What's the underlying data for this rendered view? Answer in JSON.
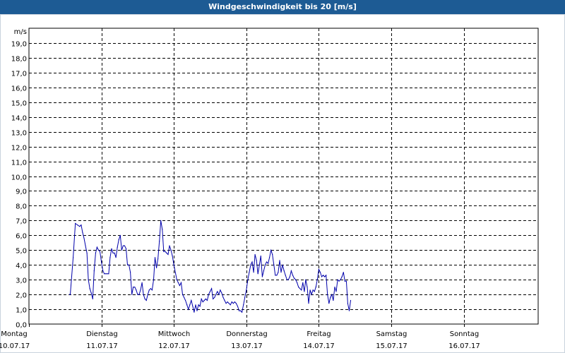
{
  "window": {
    "title": "Windgeschwindigkeit bis 20 [m/s]"
  },
  "colors": {
    "titlebar": "#1d5b94",
    "line": "#0000aa",
    "grid": "#000000"
  },
  "chart_data": {
    "type": "line",
    "title": "Windgeschwindigkeit bis 20 [m/s]",
    "ylabel": "m/s",
    "ylim": [
      0,
      20
    ],
    "xlim": [
      0,
      7
    ],
    "grid": true,
    "y_ticks": [
      "0,0",
      "1,0",
      "2,0",
      "3,0",
      "4,0",
      "5,0",
      "6,0",
      "7,0",
      "8,0",
      "9,0",
      "10,0",
      "11,0",
      "12,0",
      "13,0",
      "14,0",
      "15,0",
      "16,0",
      "17,0",
      "18,0",
      "19,0"
    ],
    "x_ticks": [
      {
        "day": "Montag",
        "date": "10.07.17",
        "pos": 0
      },
      {
        "day": "Dienstag",
        "date": "11.07.17",
        "pos": 1
      },
      {
        "day": "Mittwoch",
        "date": "12.07.17",
        "pos": 2
      },
      {
        "day": "Donnerstag",
        "date": "13.07.17",
        "pos": 3
      },
      {
        "day": "Freitag",
        "date": "14.07.17",
        "pos": 4
      },
      {
        "day": "Samstag",
        "date": "15.07.17",
        "pos": 5
      },
      {
        "day": "Sonntag",
        "date": "16.07.17",
        "pos": 6
      }
    ],
    "series": [
      {
        "points": [
          [
            0.56,
            2.0
          ],
          [
            0.57,
            2.0
          ],
          [
            0.61,
            4.5
          ],
          [
            0.64,
            6.8
          ],
          [
            0.67,
            6.7
          ],
          [
            0.7,
            6.6
          ],
          [
            0.72,
            6.7
          ],
          [
            0.74,
            6.2
          ],
          [
            0.76,
            5.8
          ],
          [
            0.78,
            5.3
          ],
          [
            0.8,
            4.8
          ],
          [
            0.82,
            3.0
          ],
          [
            0.84,
            2.4
          ],
          [
            0.86,
            2.1
          ],
          [
            0.88,
            1.7
          ],
          [
            0.9,
            3.6
          ],
          [
            0.92,
            4.8
          ],
          [
            0.94,
            5.2
          ],
          [
            0.96,
            5.0
          ],
          [
            0.98,
            4.9
          ],
          [
            1.0,
            4.2
          ],
          [
            1.02,
            3.6
          ],
          [
            1.04,
            3.4
          ],
          [
            1.06,
            3.4
          ],
          [
            1.08,
            3.4
          ],
          [
            1.1,
            3.4
          ],
          [
            1.12,
            4.5
          ],
          [
            1.14,
            5.1
          ],
          [
            1.16,
            4.8
          ],
          [
            1.18,
            4.8
          ],
          [
            1.2,
            4.5
          ],
          [
            1.22,
            5.2
          ],
          [
            1.24,
            5.7
          ],
          [
            1.26,
            6.0
          ],
          [
            1.28,
            5.0
          ],
          [
            1.3,
            5.3
          ],
          [
            1.32,
            5.3
          ],
          [
            1.34,
            5.1
          ],
          [
            1.36,
            4.0
          ],
          [
            1.38,
            4.0
          ],
          [
            1.4,
            3.5
          ],
          [
            1.42,
            2.0
          ],
          [
            1.44,
            2.5
          ],
          [
            1.46,
            2.5
          ],
          [
            1.48,
            2.3
          ],
          [
            1.5,
            2.0
          ],
          [
            1.52,
            2.0
          ],
          [
            1.54,
            2.3
          ],
          [
            1.56,
            2.8
          ],
          [
            1.58,
            2.0
          ],
          [
            1.6,
            1.7
          ],
          [
            1.62,
            1.6
          ],
          [
            1.64,
            2.0
          ],
          [
            1.66,
            2.3
          ],
          [
            1.68,
            2.4
          ],
          [
            1.7,
            2.3
          ],
          [
            1.72,
            3.0
          ],
          [
            1.74,
            4.5
          ],
          [
            1.76,
            3.8
          ],
          [
            1.78,
            4.4
          ],
          [
            1.8,
            5.6
          ],
          [
            1.82,
            7.0
          ],
          [
            1.84,
            6.4
          ],
          [
            1.86,
            4.9
          ],
          [
            1.88,
            4.9
          ],
          [
            1.9,
            4.8
          ],
          [
            1.92,
            4.7
          ],
          [
            1.94,
            5.3
          ],
          [
            1.96,
            5.0
          ],
          [
            1.98,
            4.6
          ],
          [
            2.0,
            4.0
          ],
          [
            2.02,
            3.5
          ],
          [
            2.04,
            3.0
          ],
          [
            2.06,
            2.8
          ],
          [
            2.08,
            2.6
          ],
          [
            2.1,
            2.8
          ],
          [
            2.12,
            2.0
          ],
          [
            2.14,
            1.8
          ],
          [
            2.16,
            1.6
          ],
          [
            2.18,
            1.3
          ],
          [
            2.2,
            1.0
          ],
          [
            2.22,
            1.3
          ],
          [
            2.24,
            1.6
          ],
          [
            2.26,
            1.2
          ],
          [
            2.28,
            0.8
          ],
          [
            2.3,
            1.3
          ],
          [
            2.32,
            0.9
          ],
          [
            2.34,
            1.3
          ],
          [
            2.36,
            1.2
          ],
          [
            2.38,
            1.7
          ],
          [
            2.4,
            1.5
          ],
          [
            2.42,
            1.6
          ],
          [
            2.44,
            1.7
          ],
          [
            2.46,
            1.6
          ],
          [
            2.48,
            2.0
          ],
          [
            2.5,
            2.2
          ],
          [
            2.52,
            2.4
          ],
          [
            2.54,
            1.7
          ],
          [
            2.56,
            1.8
          ],
          [
            2.58,
            2.0
          ],
          [
            2.6,
            2.2
          ],
          [
            2.62,
            2.0
          ],
          [
            2.64,
            2.3
          ],
          [
            2.66,
            2.1
          ],
          [
            2.68,
            1.8
          ],
          [
            2.7,
            1.6
          ],
          [
            2.72,
            1.4
          ],
          [
            2.74,
            1.5
          ],
          [
            2.76,
            1.4
          ],
          [
            2.78,
            1.3
          ],
          [
            2.8,
            1.5
          ],
          [
            2.82,
            1.4
          ],
          [
            2.84,
            1.5
          ],
          [
            2.86,
            1.4
          ],
          [
            2.88,
            1.2
          ],
          [
            2.9,
            0.9
          ],
          [
            2.92,
            0.9
          ],
          [
            2.94,
            0.8
          ],
          [
            2.96,
            1.3
          ],
          [
            2.98,
            1.8
          ],
          [
            3.0,
            2.3
          ],
          [
            3.02,
            3.0
          ],
          [
            3.04,
            3.5
          ],
          [
            3.06,
            4.0
          ],
          [
            3.08,
            4.2
          ],
          [
            3.1,
            3.5
          ],
          [
            3.12,
            4.7
          ],
          [
            3.14,
            4.3
          ],
          [
            3.16,
            3.4
          ],
          [
            3.18,
            4.0
          ],
          [
            3.2,
            4.6
          ],
          [
            3.22,
            3.2
          ],
          [
            3.24,
            3.6
          ],
          [
            3.26,
            4.0
          ],
          [
            3.28,
            4.2
          ],
          [
            3.3,
            4.1
          ],
          [
            3.32,
            4.5
          ],
          [
            3.34,
            5.0
          ],
          [
            3.36,
            4.7
          ],
          [
            3.38,
            4.0
          ],
          [
            3.4,
            3.3
          ],
          [
            3.42,
            3.3
          ],
          [
            3.44,
            3.5
          ],
          [
            3.46,
            4.3
          ],
          [
            3.48,
            3.5
          ],
          [
            3.5,
            4.0
          ],
          [
            3.52,
            3.6
          ],
          [
            3.54,
            3.3
          ],
          [
            3.56,
            3.0
          ],
          [
            3.58,
            3.0
          ],
          [
            3.6,
            3.2
          ],
          [
            3.62,
            3.6
          ],
          [
            3.64,
            3.3
          ],
          [
            3.66,
            3.1
          ],
          [
            3.68,
            3.0
          ],
          [
            3.7,
            2.8
          ],
          [
            3.72,
            2.5
          ],
          [
            3.74,
            2.4
          ],
          [
            3.76,
            2.3
          ],
          [
            3.78,
            2.8
          ],
          [
            3.8,
            2.2
          ],
          [
            3.82,
            3.0
          ],
          [
            3.84,
            2.5
          ],
          [
            3.86,
            1.4
          ],
          [
            3.88,
            2.3
          ],
          [
            3.9,
            2.0
          ],
          [
            3.92,
            2.3
          ],
          [
            3.94,
            2.2
          ],
          [
            3.96,
            2.5
          ],
          [
            3.98,
            3.0
          ],
          [
            4.0,
            3.7
          ],
          [
            4.02,
            3.5
          ],
          [
            4.04,
            3.2
          ],
          [
            4.06,
            3.3
          ],
          [
            4.08,
            3.2
          ],
          [
            4.1,
            3.3
          ],
          [
            4.12,
            2.0
          ],
          [
            4.14,
            1.4
          ],
          [
            4.16,
            1.8
          ],
          [
            4.18,
            2.0
          ],
          [
            4.2,
            1.6
          ],
          [
            4.22,
            2.5
          ],
          [
            4.24,
            2.2
          ],
          [
            4.26,
            3.0
          ],
          [
            4.28,
            2.9
          ],
          [
            4.3,
            3.0
          ],
          [
            4.32,
            3.2
          ],
          [
            4.34,
            3.5
          ],
          [
            4.36,
            2.9
          ],
          [
            4.38,
            2.9
          ],
          [
            4.4,
            1.4
          ],
          [
            4.42,
            0.9
          ],
          [
            4.44,
            1.6
          ]
        ]
      }
    ]
  }
}
